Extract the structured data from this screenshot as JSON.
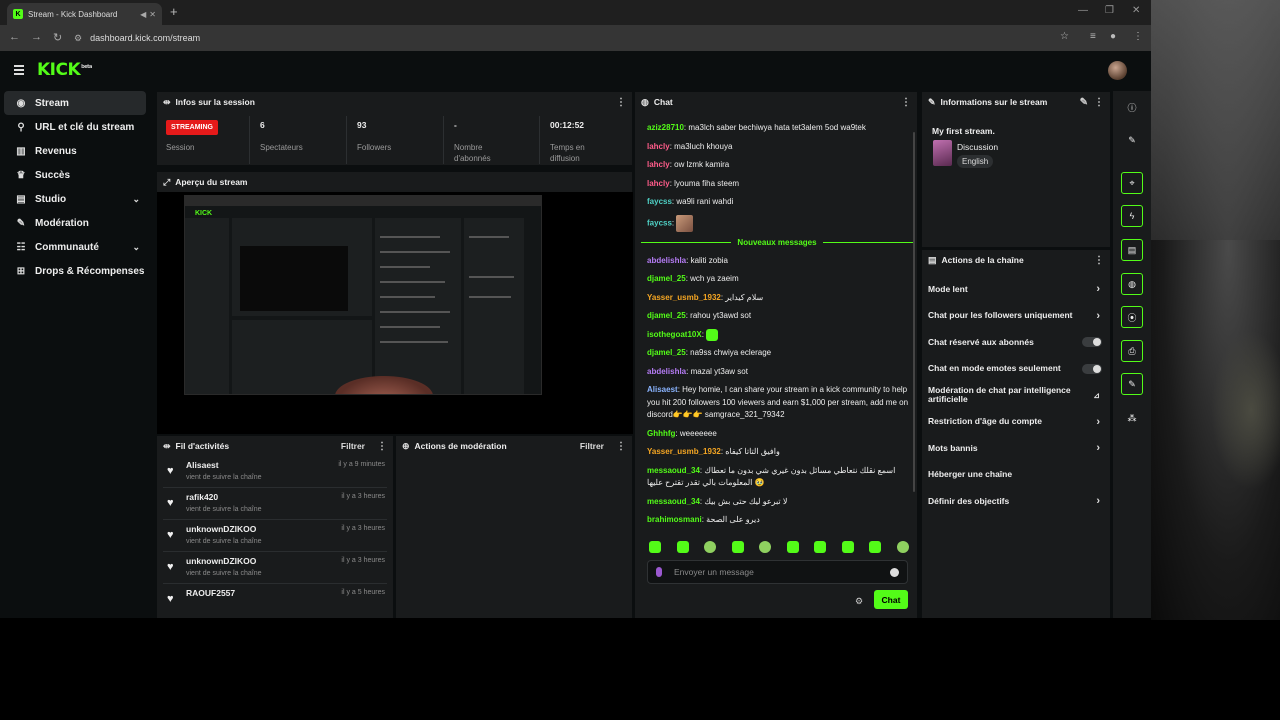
{
  "browser": {
    "tab_title": "Stream - Kick Dashboard",
    "url": "dashboard.kick.com/stream",
    "new_tab": "+"
  },
  "app": {
    "logo": "KICK",
    "logo_tag": "beta"
  },
  "sidebar": {
    "items": [
      {
        "label": "Stream",
        "icon": "video-icon",
        "glyph": "◉"
      },
      {
        "label": "URL et clé du stream",
        "icon": "link-icon",
        "glyph": "⚲"
      },
      {
        "label": "Revenus",
        "icon": "chart-icon",
        "glyph": "▥"
      },
      {
        "label": "Succès",
        "icon": "trophy-icon",
        "glyph": "♛"
      },
      {
        "label": "Studio",
        "icon": "studio-icon",
        "glyph": "▤"
      },
      {
        "label": "Modération",
        "icon": "wrench-icon",
        "glyph": "✎"
      },
      {
        "label": "Communauté",
        "icon": "community-icon",
        "glyph": "☷"
      },
      {
        "label": "Drops & Récompenses",
        "icon": "drops-icon",
        "glyph": "⊞"
      }
    ]
  },
  "session": {
    "title": "Infos sur la session",
    "live_badge": "STREAMING",
    "session_label": "Session",
    "viewers_value": "6",
    "viewers_label": "Spectateurs",
    "followers_value": "93",
    "followers_label": "Followers",
    "subs_value": "-",
    "subs_label": "Nombre d'abonnés",
    "duration_value": "00:12:52",
    "duration_label": "Temps en diffusion"
  },
  "preview": {
    "title": "Aperçu du stream"
  },
  "activity": {
    "title": "Fil d'activités",
    "filter": "Filtrer",
    "items": [
      {
        "name": "Alisaest",
        "sub": "vient de suivre la chaîne",
        "time": "il y a 9 minutes"
      },
      {
        "name": "rafik420",
        "sub": "vient de suivre la chaîne",
        "time": "il y a 3 heures"
      },
      {
        "name": "unknownDZIKOO",
        "sub": "vient de suivre la chaîne",
        "time": "il y a 3 heures"
      },
      {
        "name": "unknownDZIKOO",
        "sub": "vient de suivre la chaîne",
        "time": "il y a 3 heures"
      },
      {
        "name": "RAOUF2557",
        "sub": "",
        "time": "il y a 5 heures"
      }
    ]
  },
  "moderation": {
    "title": "Actions de modération",
    "filter": "Filtrer"
  },
  "chat": {
    "title": "Chat",
    "new_messages": "Nouveaux messages",
    "placeholder": "Envoyer un message",
    "send": "Chat",
    "colors": {
      "green": "#53fc18",
      "pink": "#ff5c8a",
      "orange": "#f5a623",
      "cyan": "#4fd1c5",
      "purple": "#b57cf5",
      "blue": "#8ab4ff"
    },
    "messages": [
      {
        "user": "aziz28710",
        "text": "ma3lch saber bechiwya hata tet3alem 5od wa9tek",
        "color": "#53fc18"
      },
      {
        "user": "lahcly",
        "text": "ma3luch khouya",
        "color": "#ff5c8a"
      },
      {
        "user": "lahcly",
        "text": "ow lzmk kamira",
        "color": "#ff5c8a"
      },
      {
        "user": "lahcly",
        "text": "lyouma fiha steem",
        "color": "#ff5c8a"
      },
      {
        "user": "faycss",
        "text": "wa9li rani wahdi",
        "color": "#4fd1c5"
      },
      {
        "user": "faycss",
        "text": "",
        "color": "#4fd1c5",
        "emote": "img"
      }
    ],
    "new_list": [
      {
        "user": "abdelishla",
        "text": "kaliti zobia",
        "color": "#b57cf5"
      },
      {
        "user": "djamel_25",
        "text": "wch ya zaeim",
        "color": "#53fc18"
      },
      {
        "user": "Yasser_usmb_1932",
        "text": "سلام كيداير",
        "color": "#f5a623"
      },
      {
        "user": "djamel_25",
        "text": "rahou yt3awd sot",
        "color": "#53fc18"
      },
      {
        "user": "isothegoat10X",
        "text": "",
        "color": "#53fc18",
        "emote": "green"
      },
      {
        "user": "djamel_25",
        "text": "na9ss chwiya eclerage",
        "color": "#53fc18"
      },
      {
        "user": "abdelishla",
        "text": "mazal yt3aw sot",
        "color": "#b57cf5"
      },
      {
        "user": "Alisaest",
        "text": "Hey homie, I can share your stream in a kick community to help you hit 200 followers 100 viewers and earn $1,000 per stream, add me on discord👉👉👉 samgrace_321_79342",
        "color": "#8ab4ff"
      },
      {
        "user": "Ghhhfg",
        "text": "weeeeeee",
        "color": "#53fc18"
      },
      {
        "user": "Yasser_usmb_1932",
        "text": "وافيق التاتا كيفاه",
        "color": "#f5a623"
      },
      {
        "user": "messaoud_34",
        "text": "اسمع نقلك نتعاطي مسائل بدون غيري شي بدون ما تعطاك المعلومات بالي تقدر تقترح عليها 🥹",
        "color": "#53fc18"
      },
      {
        "user": "messaoud_34",
        "text": "لا تبرعو ليك حتى بش بيك",
        "color": "#53fc18"
      },
      {
        "user": "brahimosmani",
        "text": "ديرو على الصحة",
        "color": "#53fc18"
      }
    ]
  },
  "stream_info": {
    "title": "Informations sur le stream",
    "stream_title": "My first stream.",
    "category": "Discussion",
    "language": "English"
  },
  "channel_actions": {
    "title": "Actions de la chaîne",
    "items": [
      {
        "label": "Mode lent",
        "control": "chevron"
      },
      {
        "label": "Chat pour les followers uniquement",
        "control": "chevron"
      },
      {
        "label": "Chat réservé aux abonnés",
        "control": "toggle"
      },
      {
        "label": "Chat en mode emotes seulement",
        "control": "toggle"
      },
      {
        "label": "Modération de chat par intelligence artificielle",
        "control": "chart"
      },
      {
        "label": "Restriction d'âge du compte",
        "control": "chevron"
      },
      {
        "label": "Mots bannis",
        "control": "chevron"
      },
      {
        "label": "Héberger une chaîne",
        "control": "none"
      },
      {
        "label": "Définir des objectifs",
        "control": "chevron"
      }
    ]
  },
  "rail": {
    "icons": [
      "info-icon",
      "pen-icon",
      "target-icon",
      "bolt-icon",
      "doc-icon",
      "chat-bubble-icon",
      "broadcast-icon",
      "print-icon",
      "wrench-icon",
      "users-icon"
    ]
  }
}
